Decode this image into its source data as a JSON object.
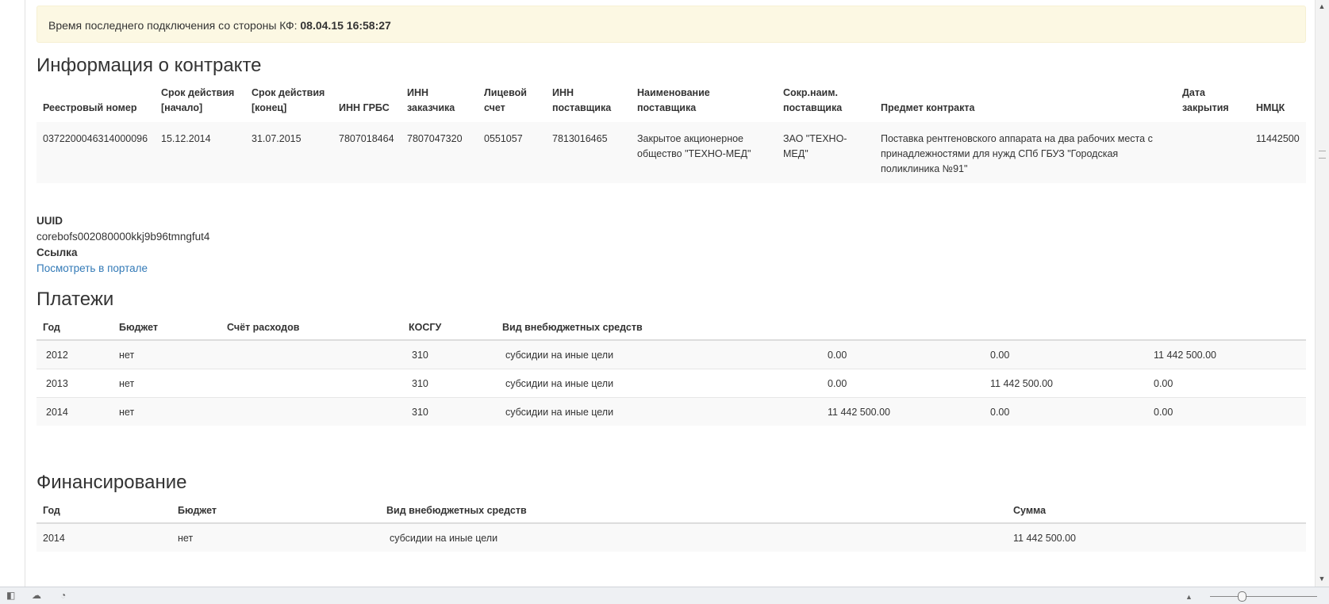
{
  "notice": {
    "label": "Время последнего подключения со стороны КФ:",
    "value": "08.04.15 16:58:27"
  },
  "contract": {
    "title": "Информация о контракте",
    "headers": [
      "Реестровый номер",
      "Срок действия [начало]",
      "Срок действия [конец]",
      "ИНН ГРБС",
      "ИНН заказчика",
      "Лицевой счет",
      "ИНН поставщика",
      "Наименование поставщика",
      "Сокр.наим. поставщика",
      "Предмет контракта",
      "Дата закрытия",
      "НМЦК"
    ],
    "row": [
      "0372200046314000096",
      "15.12.2014",
      "31.07.2015",
      "7807018464",
      "7807047320",
      "0551057",
      "7813016465",
      "Закрытое акционерное общество \"ТЕХНО-МЕД\"",
      "ЗАО \"ТЕХНО-МЕД\"",
      "Поставка рентгеновского аппарата на два рабочих места с принадлежностями для нужд СПб ГБУЗ \"Городская поликлиника №91\"",
      "",
      "11442500"
    ]
  },
  "meta": {
    "uuid_label": "UUID",
    "uuid_value": "corebofs002080000kkj9b96tmngfut4",
    "link_label": "Ссылка",
    "link_text": "Посмотреть в портале"
  },
  "payments": {
    "title": "Платежи",
    "headers": [
      "Год",
      "Бюджет",
      "Счёт расходов",
      "КОСГУ",
      "Вид внебюджетных средств",
      "",
      "",
      ""
    ],
    "rows": [
      [
        "2012",
        "нет",
        "",
        "310",
        "субсидии на иные цели",
        "0.00",
        "0.00",
        "11 442 500.00"
      ],
      [
        "2013",
        "нет",
        "",
        "310",
        "субсидии на иные цели",
        "0.00",
        "11 442 500.00",
        "0.00"
      ],
      [
        "2014",
        "нет",
        "",
        "310",
        "субсидии на иные цели",
        "11 442 500.00",
        "0.00",
        "0.00"
      ]
    ]
  },
  "financing": {
    "title": "Финансирование",
    "headers": [
      "Год",
      "Бюджет",
      "Вид внебюджетных средств",
      "Сумма"
    ],
    "rows": [
      [
        "2014",
        "нет",
        "субсидии на иные цели",
        "11 442 500.00"
      ]
    ]
  },
  "statusbar": {
    "icons": [
      "panel-toggle-icon",
      "cloud-icon",
      "gauge-icon",
      "up-arrow-icon"
    ]
  },
  "colors": {
    "notice_bg": "#fcf8e3",
    "link": "#337ab7",
    "row_alt": "#f9f9f9"
  }
}
